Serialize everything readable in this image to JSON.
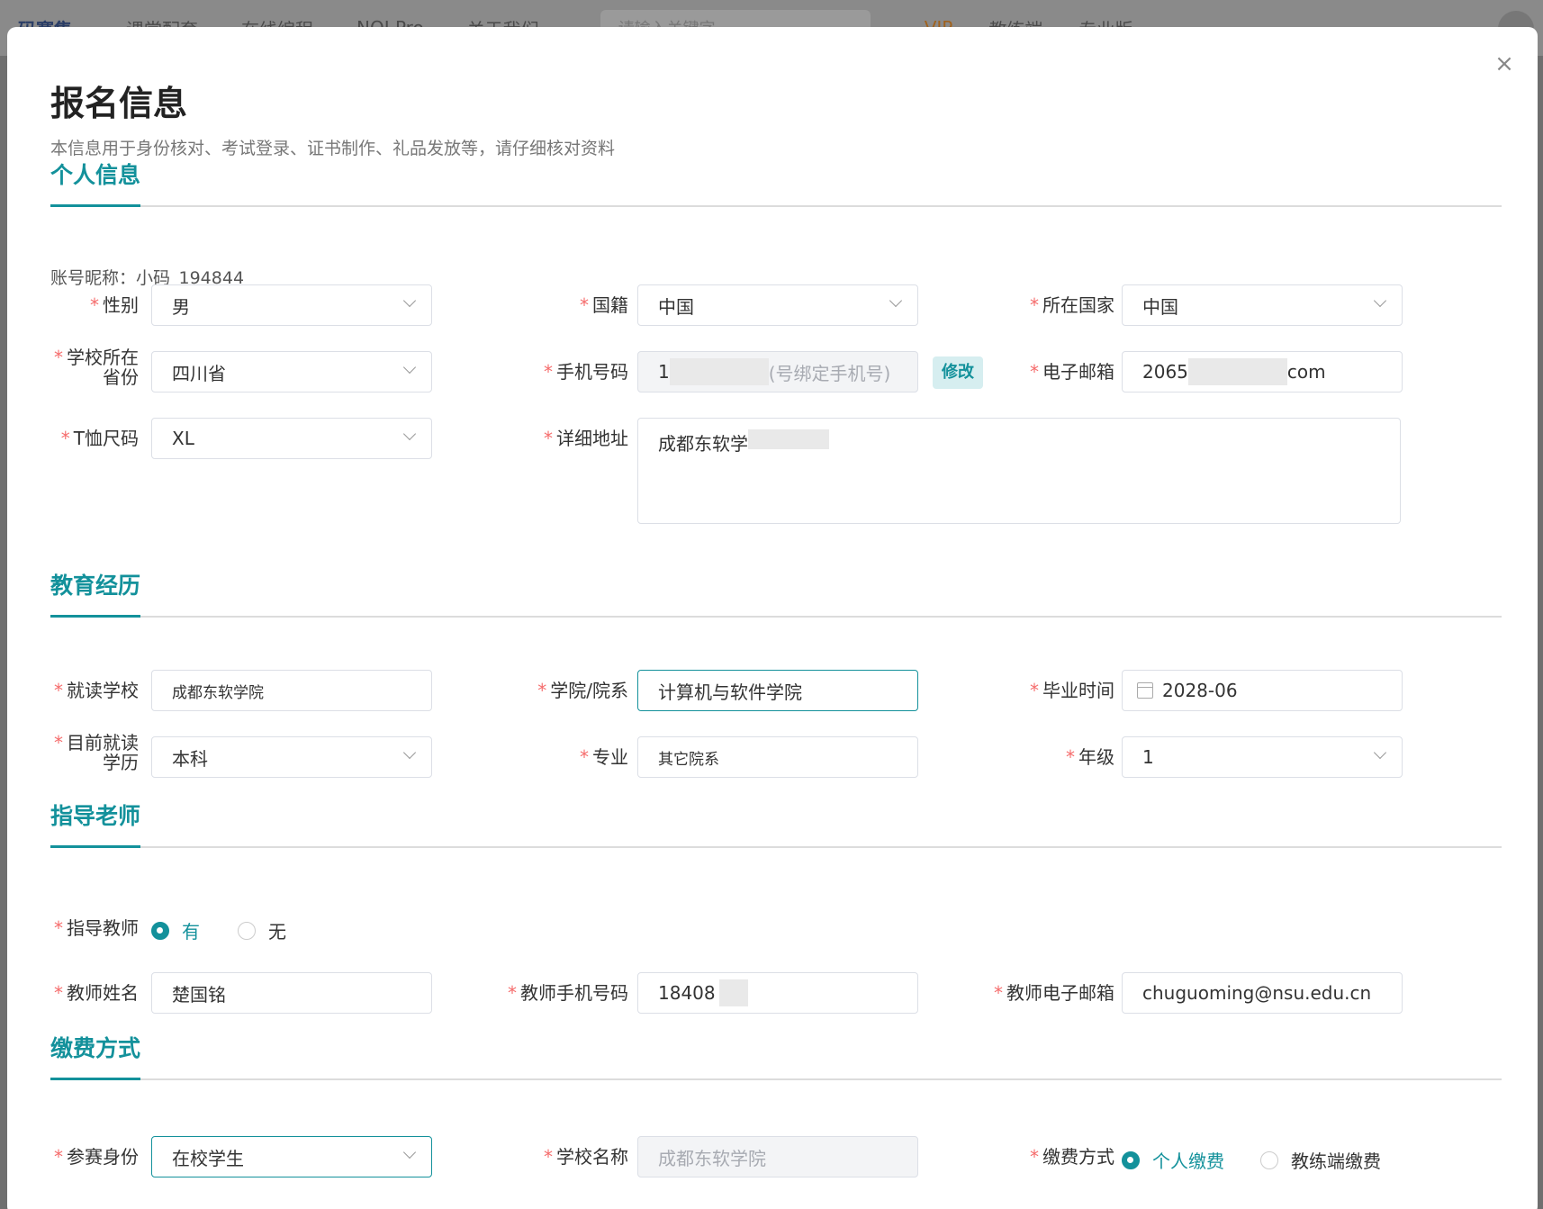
{
  "bg_nav": {
    "logo": "码赛集",
    "items": [
      "课堂配套",
      "在线编程",
      "NOI Pro",
      "关于我们"
    ],
    "search_placeholder": "请输入关键字",
    "vip": "VIP",
    "coach": "教练端",
    "pro": "专业版"
  },
  "modal": {
    "title": "报名信息",
    "subtitle": "本信息用于身份核对、考试登录、证书制作、礼品发放等，请仔细核对资料",
    "close_label": "×"
  },
  "personal": {
    "section_title": "个人信息",
    "account_label": "账号昵称：小码_194844",
    "gender": {
      "label": "性别",
      "value": "男"
    },
    "nationality": {
      "label": "国籍",
      "value": "中国"
    },
    "country": {
      "label": "所在国家",
      "value": "中国"
    },
    "province": {
      "label_line1": "学校所在",
      "label_line2": "省份",
      "value": "四川省"
    },
    "phone": {
      "label": "手机号码",
      "value_start": "1",
      "value_end": "(号绑定手机号)",
      "edit_label": "修改"
    },
    "email": {
      "label": "电子邮箱",
      "value_start": "2065",
      "value_end": "com"
    },
    "tshirt": {
      "label": "T恤尺码",
      "value": "XL"
    },
    "address": {
      "label": "详细地址",
      "value": "成都东软学"
    }
  },
  "education": {
    "section_title": "教育经历",
    "school": {
      "label": "就读学校",
      "value": "成都东软学院"
    },
    "college": {
      "label": "学院/院系",
      "value": "计算机与软件学院"
    },
    "graduation": {
      "label": "毕业时间",
      "value": "2028-06"
    },
    "degree": {
      "label_line1": "目前就读",
      "label_line2": "学历",
      "value": "本科"
    },
    "major": {
      "label": "专业",
      "value": "其它院系"
    },
    "grade": {
      "label": "年级",
      "value": "1"
    }
  },
  "teacher": {
    "section_title": "指导老师",
    "has_teacher": {
      "label": "指导教师",
      "option_yes": "有",
      "option_no": "无",
      "selected": "有"
    },
    "name": {
      "label": "教师姓名",
      "value": "楚国铭"
    },
    "phone": {
      "label": "教师手机号码",
      "value": "18408"
    },
    "email": {
      "label": "教师电子邮箱",
      "value": "chuguoming@nsu.edu.cn"
    }
  },
  "payment": {
    "section_title": "缴费方式",
    "identity": {
      "label": "参赛身份",
      "value": "在校学生"
    },
    "school_name": {
      "label": "学校名称",
      "placeholder": "成都东软学院"
    },
    "method": {
      "label": "缴费方式",
      "option_personal": "个人缴费",
      "option_coach": "教练端缴费",
      "selected": "个人缴费"
    }
  },
  "icons": {
    "close": "close-icon",
    "dropdown": "chevron-down-icon",
    "calendar": "calendar-icon"
  },
  "colors": {
    "accent": "#13919b",
    "required": "#f56c6c"
  }
}
